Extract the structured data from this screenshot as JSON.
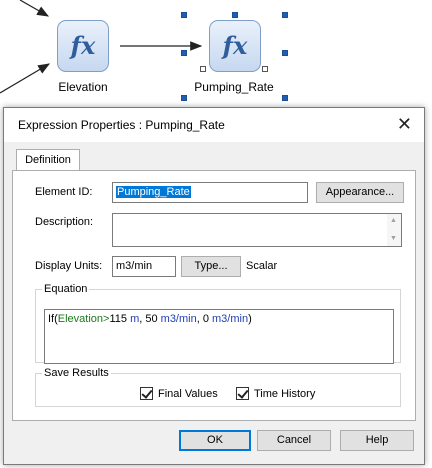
{
  "canvas": {
    "nodes": [
      {
        "label": "Elevation",
        "icon": "fx-icon",
        "glyph": "fx",
        "selected": false
      },
      {
        "label": "Pumping_Rate",
        "icon": "fx-icon",
        "glyph": "fx",
        "selected": true
      }
    ]
  },
  "dialog": {
    "title": "Expression Properties : Pumping_Rate",
    "close_glyph": "✕",
    "tabs": [
      {
        "label": "Definition",
        "active": true
      }
    ],
    "element_id": {
      "label": "Element ID:",
      "value": "Pumping_Rate"
    },
    "appearance_button": "Appearance...",
    "description": {
      "label": "Description:",
      "value": ""
    },
    "display_units": {
      "label": "Display Units:",
      "value": "m3/min",
      "type_button": "Type...",
      "type_value": "Scalar"
    },
    "equation": {
      "legend": "Equation",
      "tokens": [
        {
          "text": "If(",
          "kind": "plain"
        },
        {
          "text": "Elevation",
          "kind": "var"
        },
        {
          "text": ">",
          "kind": "op"
        },
        {
          "text": "115 ",
          "kind": "plain"
        },
        {
          "text": "m",
          "kind": "unit"
        },
        {
          "text": ", 50 ",
          "kind": "plain"
        },
        {
          "text": "m3/min",
          "kind": "unit"
        },
        {
          "text": ", 0 ",
          "kind": "plain"
        },
        {
          "text": "m3/min",
          "kind": "unit"
        },
        {
          "text": ")",
          "kind": "plain"
        }
      ]
    },
    "save_results": {
      "legend": "Save Results",
      "final_values": {
        "label": "Final Values",
        "checked": true
      },
      "time_history": {
        "label": "Time History",
        "checked": true
      }
    },
    "buttons": {
      "ok": "OK",
      "cancel": "Cancel",
      "help": "Help"
    }
  },
  "colors": {
    "accent": "#0078d7",
    "equation_variable": "#1b7a1b",
    "equation_unit": "#1f3fb5",
    "handle": "#1f5fb3"
  }
}
